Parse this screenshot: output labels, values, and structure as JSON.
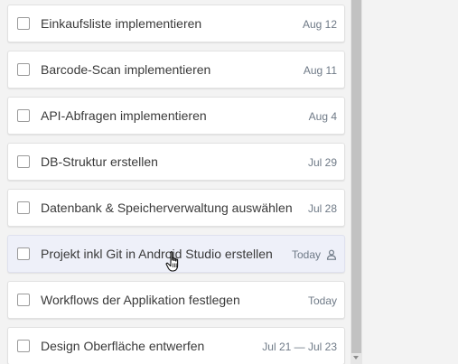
{
  "tasks": [
    {
      "title": "Einkaufsliste implementieren",
      "date": "Aug 12",
      "hovered": false,
      "assigned": false
    },
    {
      "title": "Barcode-Scan implementieren",
      "date": "Aug 11",
      "hovered": false,
      "assigned": false
    },
    {
      "title": "API-Abfragen implementieren",
      "date": "Aug 4",
      "hovered": false,
      "assigned": false
    },
    {
      "title": "DB-Struktur erstellen",
      "date": "Jul 29",
      "hovered": false,
      "assigned": false
    },
    {
      "title": "Datenbank & Speicherverwaltung auswählen",
      "date": "Jul 28",
      "hovered": false,
      "assigned": false
    },
    {
      "title": "Projekt inkl Git in Android Studio erstellen",
      "date": "Today",
      "hovered": true,
      "assigned": true
    },
    {
      "title": "Workflows der Applikation festlegen",
      "date": "Today",
      "hovered": false,
      "assigned": false
    },
    {
      "title": "Design Oberfläche entwerfen",
      "date": "Jul 21 — Jul 23",
      "hovered": false,
      "assigned": false
    }
  ],
  "icons": {
    "assignee": "user-icon",
    "cursor": "hand-pointer-icon"
  },
  "colors": {
    "hover_background": "#eef0f9",
    "date_text": "#6f7a87",
    "title_text": "#3a3a3a"
  }
}
